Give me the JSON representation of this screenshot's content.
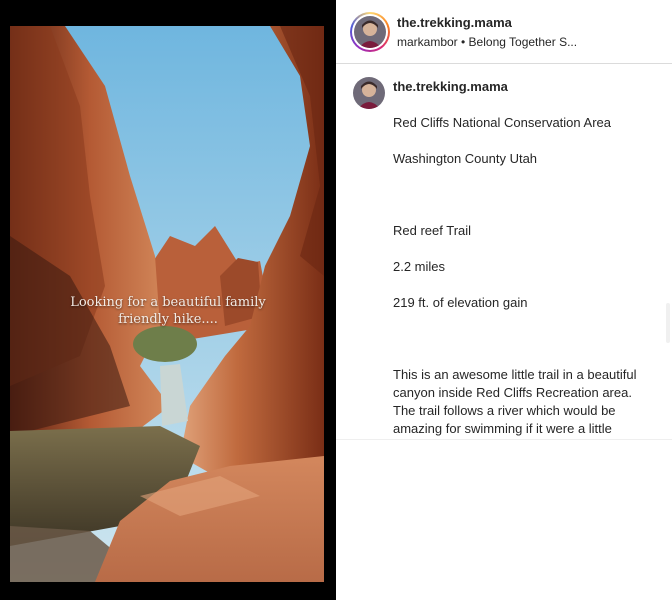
{
  "post": {
    "username": "the.trekking.mama",
    "subtitle": "markambor • Belong Together S...",
    "media_overlay_text": "Looking for a beautiful family\nfriendly hike....",
    "caption_username": "the.trekking.mama",
    "caption_lines": [
      "Red Cliffs National Conservation Area",
      "Washington County Utah",
      "",
      "Red reef Trail",
      "2.2 miles",
      "219 ft. of elevation gain",
      "",
      "This is an awesome little trail in a beautiful canyon inside Red Cliffs Recreation area. The trail follows a river which would be amazing for swimming if it were a little warmer. It's a great family friendly trail. In fact, I saw lots of kids hiking this. The trail passes several waterfalls and amazing rock formations. For me, the highlight of the trip was a small climbing problem to get up and around one of the waterfalls which had small indentations in the rock which"
    ]
  },
  "colors": {
    "media_background": "#000000",
    "text": "#262626",
    "divider": "#dbdbdb"
  }
}
